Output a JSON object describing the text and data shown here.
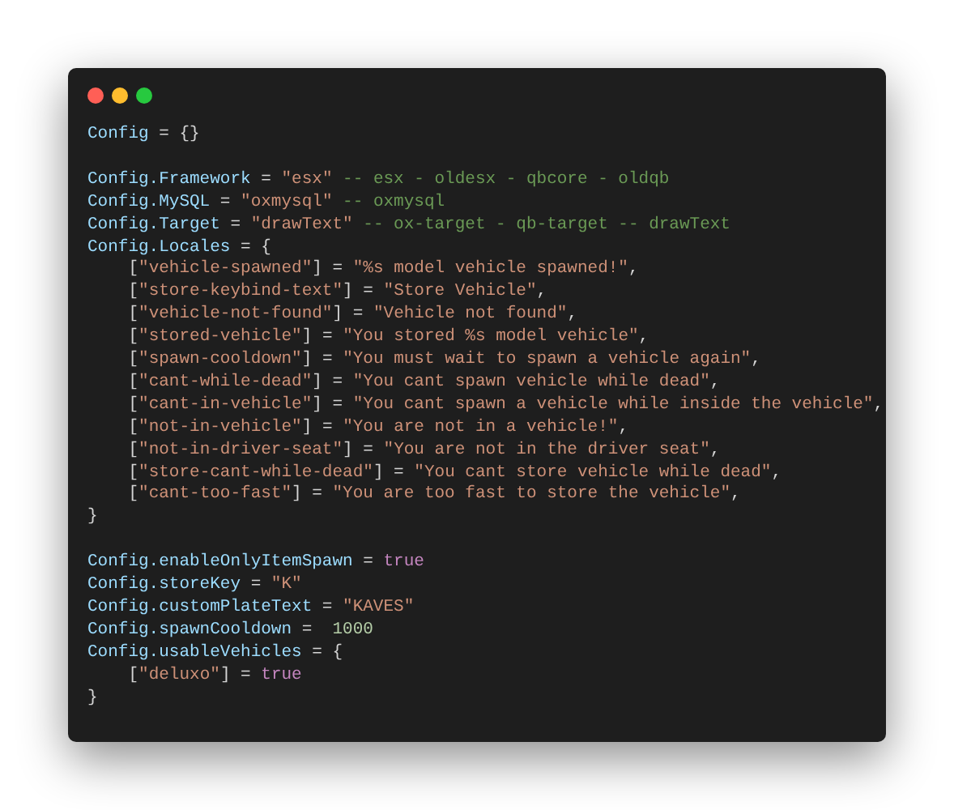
{
  "code_blocks": [
    [
      {
        "tokens": [
          {
            "kind": "id",
            "text": "Config"
          },
          {
            "kind": "op",
            "text": " = {}"
          }
        ]
      }
    ],
    [
      {
        "tokens": [
          {
            "kind": "id",
            "text": "Config.Framework"
          },
          {
            "kind": "op",
            "text": " = "
          },
          {
            "kind": "str",
            "text": "\"esx\""
          },
          {
            "kind": "cmt",
            "text": " -- esx - oldesx - qbcore - oldqb"
          }
        ]
      },
      {
        "tokens": [
          {
            "kind": "id",
            "text": "Config.MySQL"
          },
          {
            "kind": "op",
            "text": " = "
          },
          {
            "kind": "str",
            "text": "\"oxmysql\""
          },
          {
            "kind": "cmt",
            "text": " -- oxmysql"
          }
        ]
      },
      {
        "tokens": [
          {
            "kind": "id",
            "text": "Config.Target"
          },
          {
            "kind": "op",
            "text": " = "
          },
          {
            "kind": "str",
            "text": "\"drawText\""
          },
          {
            "kind": "cmt",
            "text": " -- ox-target - qb-target -- drawText"
          }
        ]
      },
      {
        "tokens": [
          {
            "kind": "id",
            "text": "Config.Locales"
          },
          {
            "kind": "op",
            "text": " = {"
          }
        ]
      },
      {
        "tokens": [
          {
            "kind": "op",
            "text": "    ["
          },
          {
            "kind": "str",
            "text": "\"vehicle-spawned\""
          },
          {
            "kind": "op",
            "text": "] = "
          },
          {
            "kind": "str",
            "text": "\"%s model vehicle spawned!\""
          },
          {
            "kind": "op",
            "text": ","
          }
        ]
      },
      {
        "tokens": [
          {
            "kind": "op",
            "text": "    ["
          },
          {
            "kind": "str",
            "text": "\"store-keybind-text\""
          },
          {
            "kind": "op",
            "text": "] = "
          },
          {
            "kind": "str",
            "text": "\"Store Vehicle\""
          },
          {
            "kind": "op",
            "text": ","
          }
        ]
      },
      {
        "tokens": [
          {
            "kind": "op",
            "text": "    ["
          },
          {
            "kind": "str",
            "text": "\"vehicle-not-found\""
          },
          {
            "kind": "op",
            "text": "] = "
          },
          {
            "kind": "str",
            "text": "\"Vehicle not found\""
          },
          {
            "kind": "op",
            "text": ","
          }
        ]
      },
      {
        "tokens": [
          {
            "kind": "op",
            "text": "    ["
          },
          {
            "kind": "str",
            "text": "\"stored-vehicle\""
          },
          {
            "kind": "op",
            "text": "] = "
          },
          {
            "kind": "str",
            "text": "\"You stored %s model vehicle\""
          },
          {
            "kind": "op",
            "text": ","
          }
        ]
      },
      {
        "tokens": [
          {
            "kind": "op",
            "text": "    ["
          },
          {
            "kind": "str",
            "text": "\"spawn-cooldown\""
          },
          {
            "kind": "op",
            "text": "] = "
          },
          {
            "kind": "str",
            "text": "\"You must wait to spawn a vehicle again\""
          },
          {
            "kind": "op",
            "text": ","
          }
        ]
      },
      {
        "tokens": [
          {
            "kind": "op",
            "text": "    ["
          },
          {
            "kind": "str",
            "text": "\"cant-while-dead\""
          },
          {
            "kind": "op",
            "text": "] = "
          },
          {
            "kind": "str",
            "text": "\"You cant spawn vehicle while dead\""
          },
          {
            "kind": "op",
            "text": ","
          }
        ]
      },
      {
        "tokens": [
          {
            "kind": "op",
            "text": "    ["
          },
          {
            "kind": "str",
            "text": "\"cant-in-vehicle\""
          },
          {
            "kind": "op",
            "text": "] = "
          },
          {
            "kind": "str",
            "text": "\"You cant spawn a vehicle while inside the vehicle\""
          },
          {
            "kind": "op",
            "text": ","
          }
        ]
      },
      {
        "tokens": [
          {
            "kind": "op",
            "text": "    ["
          },
          {
            "kind": "str",
            "text": "\"not-in-vehicle\""
          },
          {
            "kind": "op",
            "text": "] = "
          },
          {
            "kind": "str",
            "text": "\"You are not in a vehicle!\""
          },
          {
            "kind": "op",
            "text": ","
          }
        ]
      },
      {
        "tokens": [
          {
            "kind": "op",
            "text": "    ["
          },
          {
            "kind": "str",
            "text": "\"not-in-driver-seat\""
          },
          {
            "kind": "op",
            "text": "] = "
          },
          {
            "kind": "str",
            "text": "\"You are not in the driver seat\""
          },
          {
            "kind": "op",
            "text": ","
          }
        ]
      },
      {
        "tokens": [
          {
            "kind": "op",
            "text": "    ["
          },
          {
            "kind": "str",
            "text": "\"store-cant-while-dead\""
          },
          {
            "kind": "op",
            "text": "] = "
          },
          {
            "kind": "str",
            "text": "\"You cant store vehicle while dead\""
          },
          {
            "kind": "op",
            "text": ","
          }
        ]
      },
      {
        "tokens": [
          {
            "kind": "op",
            "text": "    ["
          },
          {
            "kind": "str",
            "text": "\"cant-too-fast\""
          },
          {
            "kind": "op",
            "text": "] = "
          },
          {
            "kind": "str",
            "text": "\"You are too fast to store the vehicle\""
          },
          {
            "kind": "op",
            "text": ","
          }
        ]
      },
      {
        "tokens": [
          {
            "kind": "op",
            "text": "}"
          }
        ]
      }
    ],
    [
      {
        "tokens": [
          {
            "kind": "id",
            "text": "Config.enableOnlyItemSpawn"
          },
          {
            "kind": "op",
            "text": " = "
          },
          {
            "kind": "bool",
            "text": "true"
          }
        ]
      },
      {
        "tokens": [
          {
            "kind": "id",
            "text": "Config.storeKey"
          },
          {
            "kind": "op",
            "text": " = "
          },
          {
            "kind": "str",
            "text": "\"K\""
          }
        ]
      },
      {
        "tokens": [
          {
            "kind": "id",
            "text": "Config.customPlateText"
          },
          {
            "kind": "op",
            "text": " = "
          },
          {
            "kind": "str",
            "text": "\"KAVES\""
          }
        ]
      },
      {
        "tokens": [
          {
            "kind": "id",
            "text": "Config.spawnCooldown"
          },
          {
            "kind": "op",
            "text": " =  "
          },
          {
            "kind": "num",
            "text": "1000"
          }
        ]
      },
      {
        "tokens": [
          {
            "kind": "id",
            "text": "Config.usableVehicles"
          },
          {
            "kind": "op",
            "text": " = {"
          }
        ]
      },
      {
        "tokens": [
          {
            "kind": "op",
            "text": "    ["
          },
          {
            "kind": "str",
            "text": "\"deluxo\""
          },
          {
            "kind": "op",
            "text": "] = "
          },
          {
            "kind": "bool",
            "text": "true"
          }
        ]
      },
      {
        "tokens": [
          {
            "kind": "op",
            "text": "}"
          }
        ]
      }
    ]
  ]
}
